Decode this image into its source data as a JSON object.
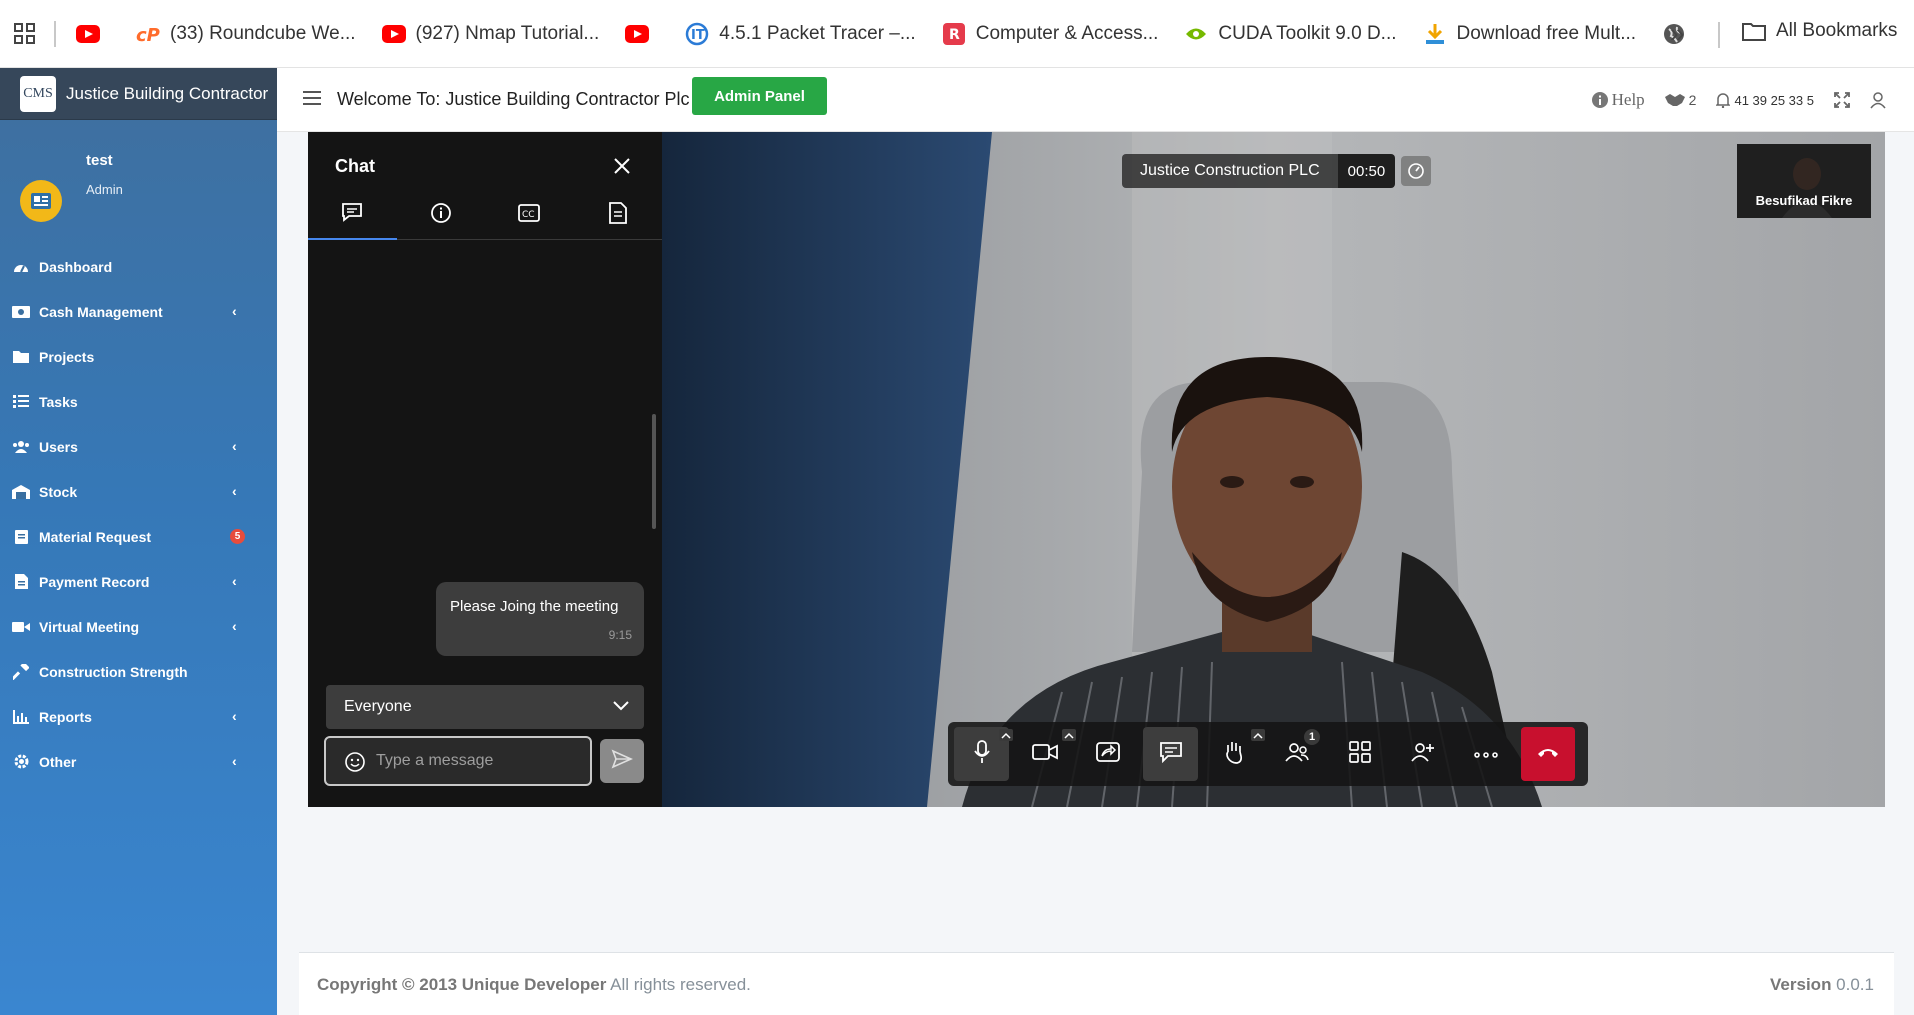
{
  "bookmarks": {
    "items": [
      {
        "label": "",
        "icon": "youtube-icon",
        "color": "#ff0000"
      },
      {
        "label": "(33) Roundcube We...",
        "icon": "cpanel-icon",
        "color": "#ff6c2c"
      },
      {
        "label": "(927) Nmap Tutorial...",
        "icon": "youtube-icon",
        "color": "#ff0000"
      },
      {
        "label": "",
        "icon": "youtube-icon",
        "color": "#ff0000"
      },
      {
        "label": "4.5.1 Packet Tracer –...",
        "icon": "it-icon",
        "color": "#2b7bd6"
      },
      {
        "label": "Computer & Access...",
        "icon": "r-icon",
        "color": "#e53b4b"
      },
      {
        "label": "CUDA Toolkit 9.0 D...",
        "icon": "nvidia-icon",
        "color": "#76b900"
      },
      {
        "label": "Download free Mult...",
        "icon": "download-icon",
        "color": "#f1a400"
      }
    ],
    "all_label": "All Bookmarks"
  },
  "sidebar": {
    "brand_logo": "CMS",
    "brand_name": "Justice Building Contractor",
    "user_name": "test",
    "user_role": "Admin",
    "items": [
      {
        "label": "Dashboard",
        "icon": "dashboard-icon",
        "chevron": false
      },
      {
        "label": "Cash Management",
        "icon": "cash-icon",
        "chevron": true
      },
      {
        "label": "Projects",
        "icon": "folder-icon",
        "chevron": false
      },
      {
        "label": "Tasks",
        "icon": "tasks-icon",
        "chevron": false
      },
      {
        "label": "Users",
        "icon": "users-icon",
        "chevron": true
      },
      {
        "label": "Stock",
        "icon": "warehouse-icon",
        "chevron": true
      },
      {
        "label": "Material Request",
        "icon": "clipboard-icon",
        "chevron": false,
        "badge": "5"
      },
      {
        "label": "Payment Record",
        "icon": "file-icon",
        "chevron": true
      },
      {
        "label": "Virtual Meeting",
        "icon": "video-icon",
        "chevron": true
      },
      {
        "label": "Construction Strength",
        "icon": "hammer-icon",
        "chevron": false
      },
      {
        "label": "Reports",
        "icon": "chart-icon",
        "chevron": true
      },
      {
        "label": "Other",
        "icon": "gear-icon",
        "chevron": true
      }
    ]
  },
  "topnav": {
    "welcome": "Welcome To: Justice Building Contractor Plc",
    "admin_panel": "Admin Panel",
    "help": "Help",
    "handshake_count": "2",
    "notif_text": "41 39 25 33 5"
  },
  "meeting": {
    "chat_title": "Chat",
    "message_text": "Please Joing the meeting",
    "message_time": "9:15",
    "recipient": "Everyone",
    "input_placeholder": "Type a message",
    "room_name": "Justice Construction PLC",
    "timer": "00:50",
    "thumb_name": "Besufikad Fikre",
    "participants_count": "1"
  },
  "footer": {
    "copyright_bold": "Copyright © 2013 Unique Developer",
    "copyright_rest": " All rights reserved.",
    "version_label": "Version",
    "version_value": " 0.0.1"
  }
}
